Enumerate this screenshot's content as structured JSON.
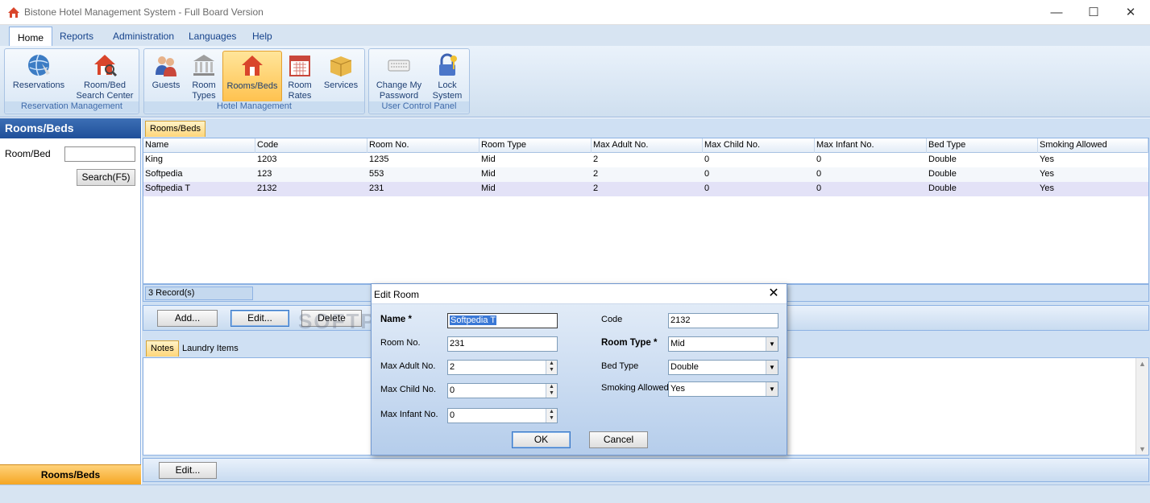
{
  "window": {
    "title": "Bistone Hotel Management System - Full Board Version",
    "minimize": "—",
    "maximize": "☐",
    "close": "✕"
  },
  "menu": {
    "tabs": [
      "Home",
      "Reports",
      "Administration",
      "Languages",
      "Help"
    ],
    "active": "Home"
  },
  "ribbon": {
    "groups": [
      {
        "label": "Reservation Management",
        "buttons": [
          {
            "label1": "Reservations",
            "label2": "",
            "icon": "globe-icon"
          },
          {
            "label1": "Room/Bed",
            "label2": "Search Center",
            "icon": "house-search-icon"
          }
        ]
      },
      {
        "label": "Hotel Management",
        "buttons": [
          {
            "label1": "Guests",
            "label2": "",
            "icon": "people-icon"
          },
          {
            "label1": "Room",
            "label2": "Types",
            "icon": "building-icon"
          },
          {
            "label1": "Rooms/Beds",
            "label2": "",
            "icon": "house-icon"
          },
          {
            "label1": "Room",
            "label2": "Rates",
            "icon": "calendar-icon"
          },
          {
            "label1": "Services",
            "label2": "",
            "icon": "box-icon"
          }
        ]
      },
      {
        "label": "User Control Panel",
        "buttons": [
          {
            "label1": "Change My",
            "label2": "Password",
            "icon": "keyboard-icon"
          },
          {
            "label1": "Lock",
            "label2": "System",
            "icon": "lock-icon"
          }
        ]
      }
    ]
  },
  "left": {
    "title": "Rooms/Beds",
    "field_label": "Room/Bed",
    "field_value": "",
    "search_label": "Search(F5)",
    "footer": "Rooms/Beds"
  },
  "grid": {
    "tab": "Rooms/Beds",
    "columns": [
      "Name",
      "Code",
      "Room No.",
      "Room Type",
      "Max Adult No.",
      "Max Child No.",
      "Max Infant No.",
      "Bed Type",
      "Smoking Allowed"
    ],
    "rows": [
      [
        "King",
        "1203",
        "1235",
        "Mid",
        "2",
        "0",
        "0",
        "Double",
        "Yes"
      ],
      [
        "Softpedia",
        "123",
        "553",
        "Mid",
        "2",
        "0",
        "0",
        "Double",
        "Yes"
      ],
      [
        "Softpedia T",
        "2132",
        "231",
        "Mid",
        "2",
        "0",
        "0",
        "Double",
        "Yes"
      ]
    ],
    "selected_row": 2,
    "record_count": "3 Record(s)"
  },
  "buttons": {
    "add": "Add...",
    "edit": "Edit...",
    "delete": "Delete",
    "edit2": "Edit..."
  },
  "notes": {
    "tabs": [
      "Notes",
      "Laundry Items"
    ]
  },
  "watermark": "SOFTPEDIA",
  "dialog": {
    "title": "Edit Room",
    "name_label": "Name *",
    "name_value": "Softpedia T",
    "code_label": "Code",
    "code_value": "2132",
    "room_no_label": "Room No.",
    "room_no_value": "231",
    "room_type_label": "Room Type *",
    "room_type_value": "Mid",
    "max_adult_label": "Max Adult No.",
    "max_adult_value": "2",
    "bed_type_label": "Bed Type",
    "bed_type_value": "Double",
    "max_child_label": "Max Child No.",
    "max_child_value": "0",
    "smoking_label": "Smoking Allowed",
    "smoking_value": "Yes",
    "max_infant_label": "Max Infant No.",
    "max_infant_value": "0",
    "ok": "OK",
    "cancel": "Cancel"
  }
}
